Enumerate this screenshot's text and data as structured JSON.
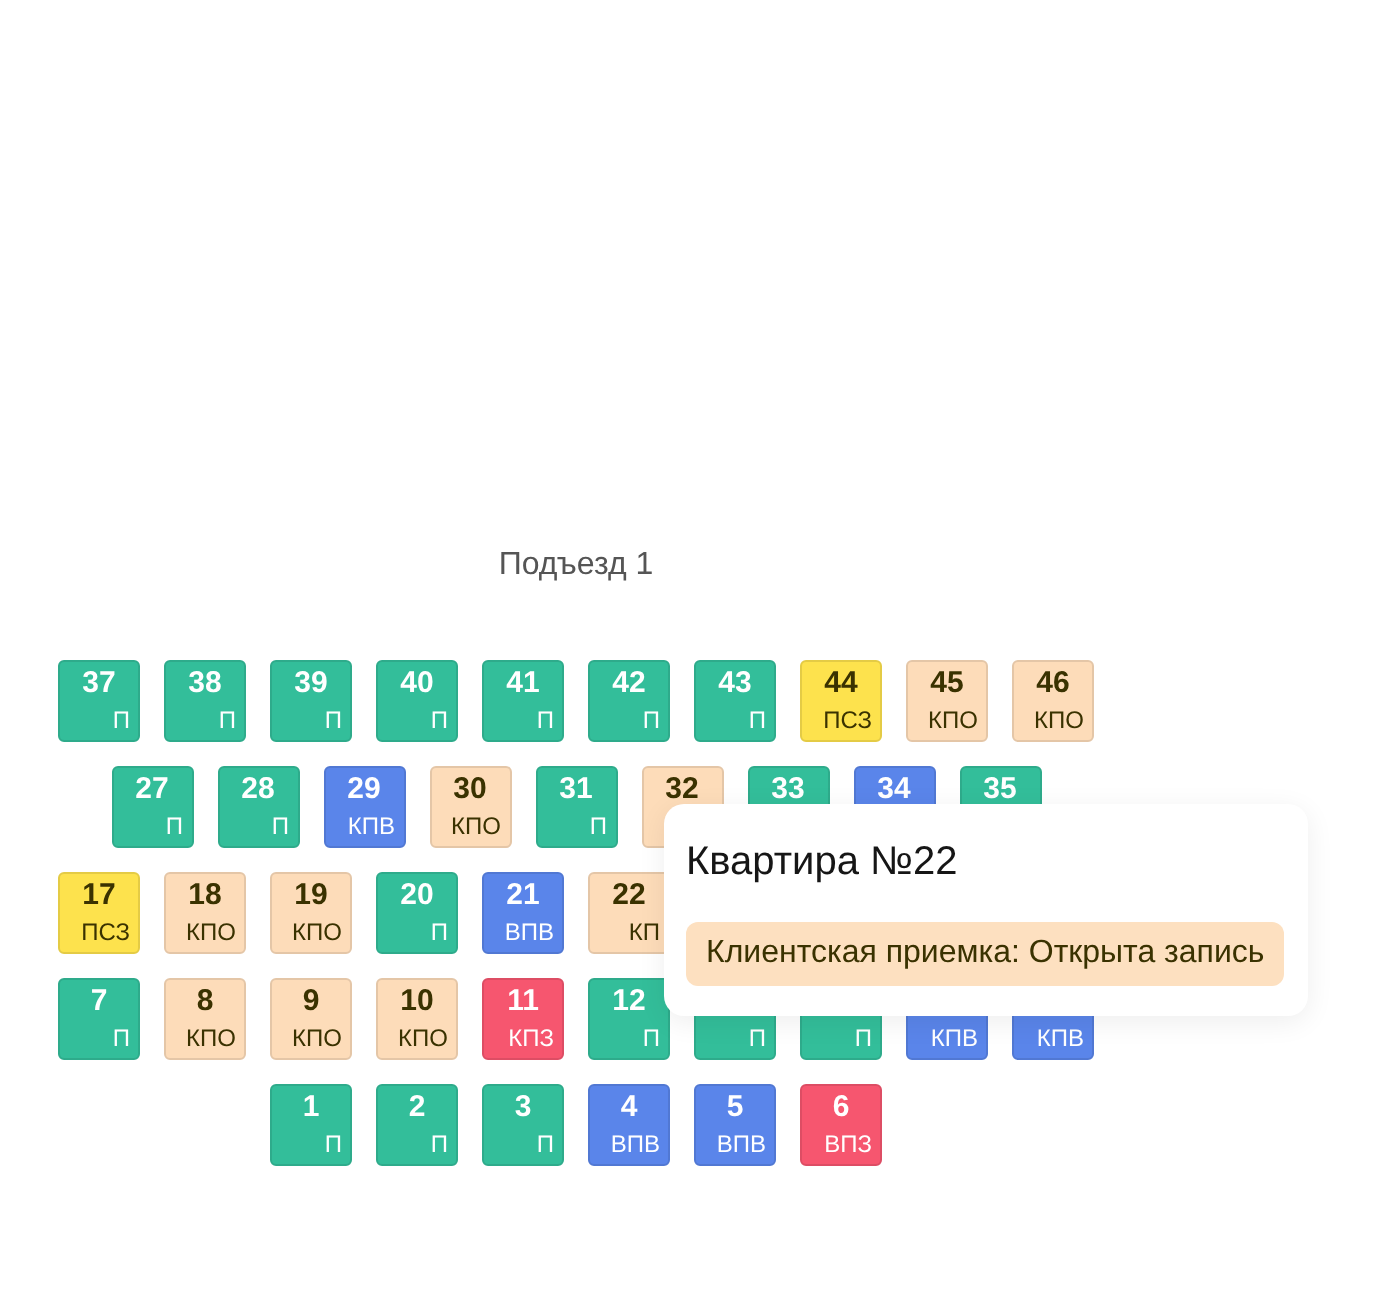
{
  "entrance": {
    "title": "Подъезд 1"
  },
  "floors": [
    {
      "apartments": [
        {
          "number": "37",
          "code": "П",
          "color": "#33be9a"
        },
        {
          "number": "38",
          "code": "П",
          "color": "#33be9a"
        },
        {
          "number": "39",
          "code": "П",
          "color": "#33be9a"
        },
        {
          "number": "40",
          "code": "П",
          "color": "#33be9a"
        },
        {
          "number": "41",
          "code": "П",
          "color": "#33be9a"
        },
        {
          "number": "42",
          "code": "П",
          "color": "#33be9a"
        },
        {
          "number": "43",
          "code": "П",
          "color": "#33be9a"
        },
        {
          "number": "44",
          "code": "ПСЗ",
          "color": "#fde24d"
        },
        {
          "number": "45",
          "code": "КПО",
          "color": "#fddcb9"
        },
        {
          "number": "46",
          "code": "КПО",
          "color": "#fddcb9"
        }
      ]
    },
    {
      "apartments": [
        {
          "number": "27",
          "code": "П",
          "color": "#33be9a"
        },
        {
          "number": "28",
          "code": "П",
          "color": "#33be9a"
        },
        {
          "number": "29",
          "code": "КПВ",
          "color": "#5a85ea"
        },
        {
          "number": "30",
          "code": "КПО",
          "color": "#fddcb9"
        },
        {
          "number": "31",
          "code": "П",
          "color": "#33be9a"
        },
        {
          "number": "32",
          "color": "#fddcb9"
        },
        {
          "number": "33",
          "color": "#33be9a"
        },
        {
          "number": "34",
          "color": "#5a85ea"
        },
        {
          "number": "35",
          "color": "#33be9a"
        }
      ]
    },
    {
      "apartments": [
        {
          "number": "17",
          "code": "ПСЗ",
          "color": "#fde24d"
        },
        {
          "number": "18",
          "code": "КПО",
          "color": "#fddcb9"
        },
        {
          "number": "19",
          "code": "КПО",
          "color": "#fddcb9"
        },
        {
          "number": "20",
          "code": "П",
          "color": "#33be9a"
        },
        {
          "number": "21",
          "code": "ВПВ",
          "color": "#5a85ea"
        },
        {
          "number": "22",
          "code": "КП",
          "color": "#fddcb9"
        }
      ]
    },
    {
      "apartments": [
        {
          "number": "7",
          "code": "П",
          "color": "#33be9a"
        },
        {
          "number": "8",
          "code": "КПО",
          "color": "#fddcb9"
        },
        {
          "number": "9",
          "code": "КПО",
          "color": "#fddcb9"
        },
        {
          "number": "10",
          "code": "КПО",
          "color": "#fddcb9"
        },
        {
          "number": "11",
          "code": "КПЗ",
          "color": "#f6566f"
        },
        {
          "number": "12",
          "code": "П",
          "color": "#33be9a"
        },
        {
          "code": "П",
          "color": "#33be9a"
        },
        {
          "code": "П",
          "color": "#33be9a"
        },
        {
          "code": "КПВ",
          "color": "#5a85ea"
        },
        {
          "code": "КПВ",
          "color": "#5a85ea"
        }
      ]
    },
    {
      "apartments": [
        {
          "number": "1",
          "code": "П",
          "color": "#33be9a"
        },
        {
          "number": "2",
          "code": "П",
          "color": "#33be9a"
        },
        {
          "number": "3",
          "code": "П",
          "color": "#33be9a"
        },
        {
          "number": "4",
          "code": "ВПВ",
          "color": "#5a85ea"
        },
        {
          "number": "5",
          "code": "ВПВ",
          "color": "#5a85ea"
        },
        {
          "number": "6",
          "code": "ВПЗ",
          "color": "#f6566f"
        }
      ]
    }
  ],
  "tooltip": {
    "title": "Квартира №22",
    "status": "Клиентская приемка: Открыта запись"
  }
}
